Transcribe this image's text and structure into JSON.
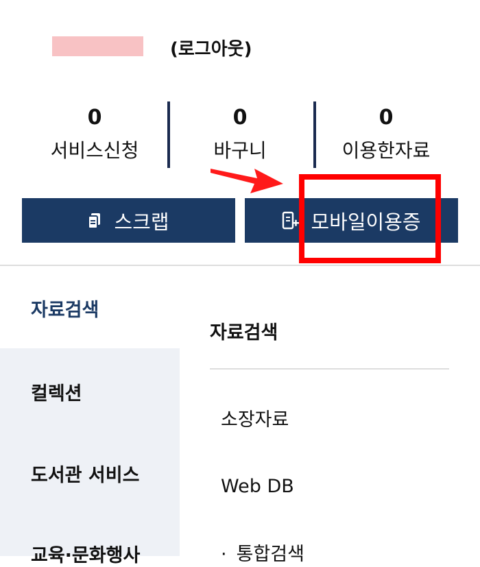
{
  "header": {
    "logout_label": "(로그아웃)"
  },
  "stats": [
    {
      "count": "0",
      "label": "서비스신청"
    },
    {
      "count": "0",
      "label": "바구니"
    },
    {
      "count": "0",
      "label": "이용한자료"
    }
  ],
  "actions": {
    "scrap_label": "스크랩",
    "mobile_card_label": "모바일이용증"
  },
  "sidebar": {
    "items": [
      {
        "label": "자료검색",
        "active": true
      },
      {
        "label": "컬렉션"
      },
      {
        "label": "도서관 서비스"
      },
      {
        "label": "교육·문화행사"
      }
    ]
  },
  "panel": {
    "title": "자료검색",
    "items": [
      {
        "label": "소장자료"
      },
      {
        "label": "Web DB"
      },
      {
        "label": "통합검색"
      }
    ]
  },
  "colors": {
    "primary": "#1b3a64",
    "highlight": "#ff0000",
    "nav_background": "#eef1f6"
  },
  "icons": [
    "document-icon",
    "mobile-card-icon",
    "red-arrow-icon"
  ]
}
